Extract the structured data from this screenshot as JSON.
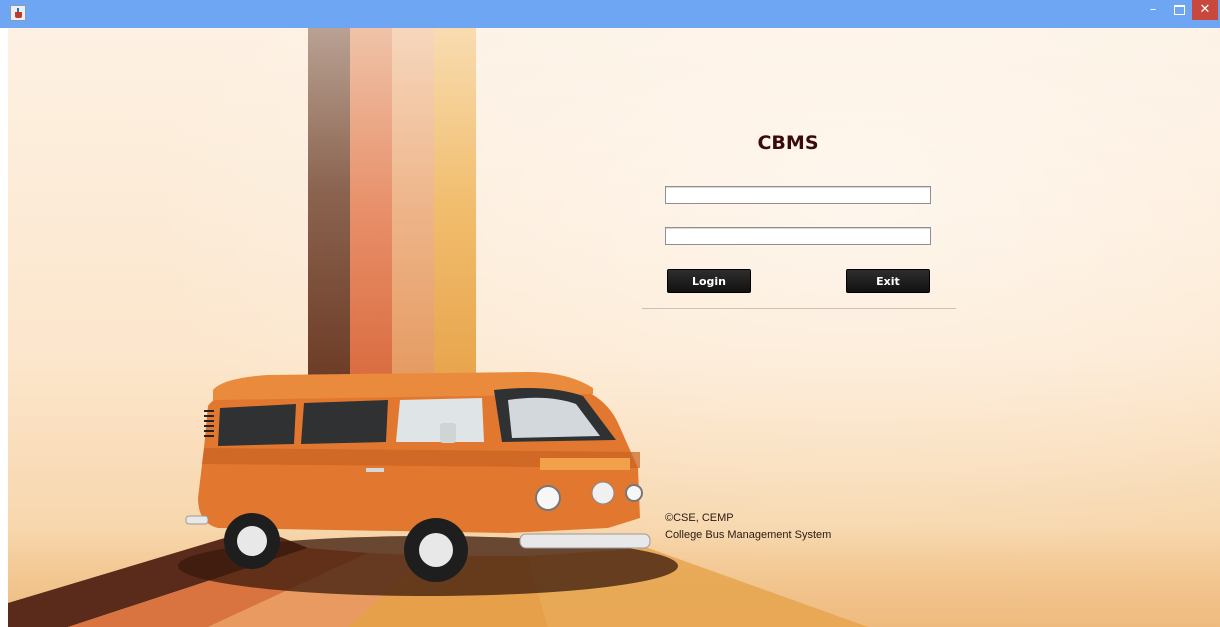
{
  "window": {
    "controls": {
      "minimize": "–",
      "close": "✕"
    }
  },
  "colors": {
    "titlebar": "#6ea6f3",
    "button_bg": "#1a1a1a",
    "title_text": "#3a0a0a",
    "van_orange": "#e2782f"
  },
  "icons": [
    "java-app-icon",
    "minimize-icon",
    "maximize-icon",
    "close-icon"
  ],
  "login": {
    "title": "CBMS",
    "username": {
      "value": "",
      "placeholder": ""
    },
    "password": {
      "value": "",
      "placeholder": ""
    },
    "login_label": "Login",
    "exit_label": "Exit"
  },
  "footer": {
    "copyright": "©CSE, CEMP",
    "app_name": "College Bus Management System"
  }
}
